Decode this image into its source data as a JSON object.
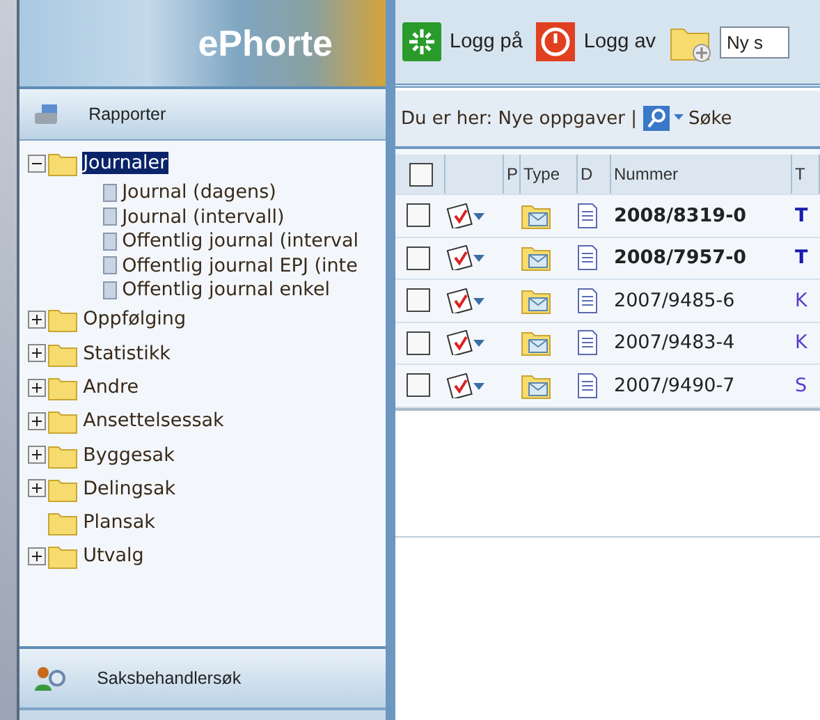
{
  "sidebar": {
    "logo": "ePhorte",
    "reports_header": "Rapporter",
    "tree": [
      {
        "label": "Journaler",
        "kind": "branch",
        "expanded": true,
        "selected": true,
        "children": [
          {
            "label": "Journal (dagens)"
          },
          {
            "label": "Journal (intervall)"
          },
          {
            "label": "Offentlig journal (interval"
          },
          {
            "label": "Offentlig journal EPJ (inte"
          },
          {
            "label": "Offentlig journal enkel"
          }
        ]
      },
      {
        "label": "Oppfølging",
        "kind": "branch",
        "expanded": false,
        "selected": false
      },
      {
        "label": "Statistikk",
        "kind": "branch",
        "expanded": false,
        "selected": false
      },
      {
        "label": "Andre",
        "kind": "branch",
        "expanded": false,
        "selected": false
      },
      {
        "label": "Ansettelsessak",
        "kind": "branch",
        "expanded": false,
        "selected": false
      },
      {
        "label": "Byggesak",
        "kind": "branch",
        "expanded": false,
        "selected": false
      },
      {
        "label": "Delingsak",
        "kind": "branch",
        "expanded": false,
        "selected": false
      },
      {
        "label": "Plansak",
        "kind": "empty",
        "selected": false
      },
      {
        "label": "Utvalg",
        "kind": "branch",
        "expanded": false,
        "selected": false
      }
    ],
    "search_header": "Saksbehandlersøk"
  },
  "toolbar": {
    "login": "Logg på",
    "logout": "Logg av",
    "new_field": "Ny s"
  },
  "breadcrumb": {
    "text": "Du er her: Nye oppgaver |",
    "search": "Søke"
  },
  "table": {
    "select_all_checked": false,
    "columns": [
      "P",
      "Type",
      "D",
      "Nummer",
      "T"
    ],
    "rows": [
      {
        "checked": false,
        "bold": true,
        "number": "2008/8319-0",
        "title": "T"
      },
      {
        "checked": false,
        "bold": true,
        "number": "2008/7957-0",
        "title": "T"
      },
      {
        "checked": false,
        "bold": false,
        "number": "2007/9485-6",
        "title": "K"
      },
      {
        "checked": false,
        "bold": false,
        "number": "2007/9483-4",
        "title": "K"
      },
      {
        "checked": false,
        "bold": false,
        "number": "2007/9490-7",
        "title": "S"
      }
    ]
  }
}
